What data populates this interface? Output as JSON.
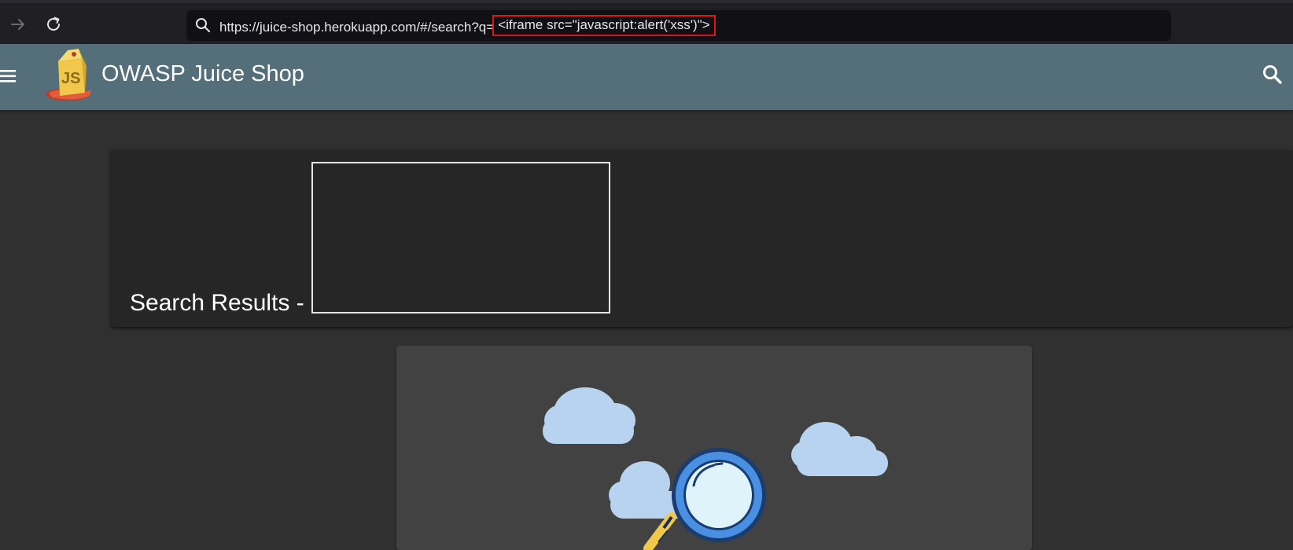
{
  "browser": {
    "url_prefix": "https://juice-shop.herokuapp.com/#/search?q=",
    "url_query": "<iframe src=\"javascript:alert('xss')\">",
    "forward_icon": "arrow-right-icon",
    "reload_icon": "reload-icon",
    "search_icon": "search-icon"
  },
  "toolbar": {
    "menu_icon": "hamburger-menu-icon",
    "app_title": "OWASP Juice Shop",
    "search_icon": "search-icon"
  },
  "search": {
    "heading": "Search Results -"
  },
  "colors": {
    "toolbar": "#546e7a",
    "page_background": "#303030",
    "card_background": "#262626",
    "result_card": "#424242",
    "highlight_border": "#e0141b"
  }
}
